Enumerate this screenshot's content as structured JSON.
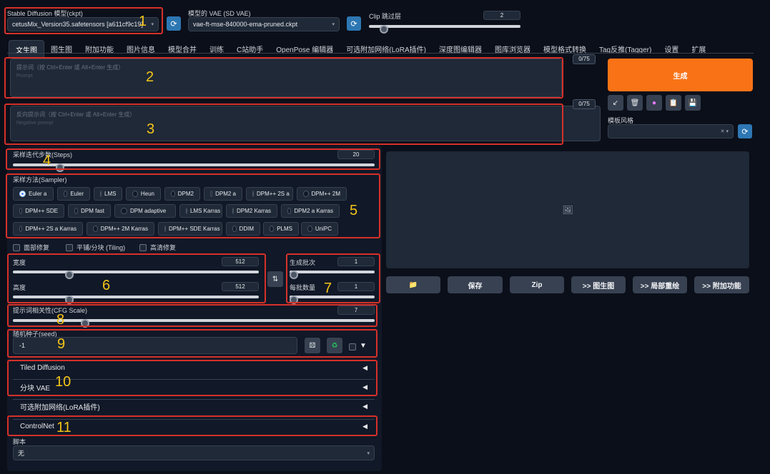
{
  "top": {
    "model_label": "Stable Diffusion 模型(ckpt)",
    "model_value": "cetusMix_Version35.safetensors [a611cf9c19]",
    "vae_label": "模型的 VAE (SD VAE)",
    "vae_value": "vae-ft-mse-840000-ema-pruned.ckpt",
    "clip_label": "Clip 跳过层",
    "clip_value": "2",
    "clip_fraction": 0.1
  },
  "tabs": [
    "文生图",
    "图生图",
    "附加功能",
    "图片信息",
    "模型合并",
    "训练",
    "C站助手",
    "OpenPose 编辑器",
    "可选附加网络(LoRA插件)",
    "深度图编辑器",
    "图库浏览器",
    "模型格式转换",
    "Tag反推(Tagger)",
    "设置",
    "扩展"
  ],
  "prompt": {
    "placeholder": "提示词（按 Ctrl+Enter 或 Alt+Enter 生成）",
    "placeholder_en": "Prompt",
    "counter": "0/75"
  },
  "negative": {
    "placeholder": "反向提示词（按 Ctrl+Enter 或 Alt+Enter 生成）",
    "placeholder_en": "Negative prompt",
    "counter": "0/75"
  },
  "generate_label": "生成",
  "style_label": "模板风格",
  "steps": {
    "label": "采样迭代步数(Steps)",
    "value": "20",
    "fraction": 0.13
  },
  "sampler": {
    "label": "采样方法(Sampler)",
    "options": [
      "Euler a",
      "Euler",
      "LMS",
      "Heun",
      "DPM2",
      "DPM2 a",
      "DPM++ 2S a",
      "DPM++ 2M",
      "DPM++ SDE",
      "DPM fast",
      "DPM adaptive",
      "LMS Karras",
      "DPM2 Karras",
      "DPM2 a Karras",
      "DPM++ 2S a Karras",
      "DPM++ 2M Karras",
      "DPM++ SDE Karras",
      "DDIM",
      "PLMS",
      "UniPC"
    ],
    "selected": "Euler a"
  },
  "checks": [
    "面部修复",
    "平铺/分块 (Tiling)",
    "高清修复"
  ],
  "width": {
    "label": "宽度",
    "value": "512",
    "fraction": 0.23
  },
  "height": {
    "label": "高度",
    "value": "512",
    "fraction": 0.23
  },
  "batch_count": {
    "label": "生成批次",
    "value": "1",
    "fraction": 0
  },
  "batch_size": {
    "label": "每批数量",
    "value": "1",
    "fraction": 0
  },
  "cfg": {
    "label": "提示词相关性(CFG Scale)",
    "value": "7",
    "fraction": 0.2
  },
  "seed": {
    "label": "随机种子(seed)",
    "value": "-1"
  },
  "accordions": [
    "Tiled Diffusion",
    "分块 VAE",
    "可选附加网络(LoRA插件)",
    "ControlNet"
  ],
  "script": {
    "label": "脚本",
    "value": "无"
  },
  "output_buttons": [
    "保存",
    "Zip",
    ">> 图生图",
    ">> 局部重绘",
    ">> 附加功能"
  ],
  "annotations": [
    "1",
    "2",
    "3",
    "4",
    "5",
    "6",
    "7",
    "8",
    "9",
    "10",
    "11"
  ],
  "colors": {
    "accent": "#f97316",
    "annotation_box": "#d6312a",
    "annotation_num": "#f5c518"
  }
}
